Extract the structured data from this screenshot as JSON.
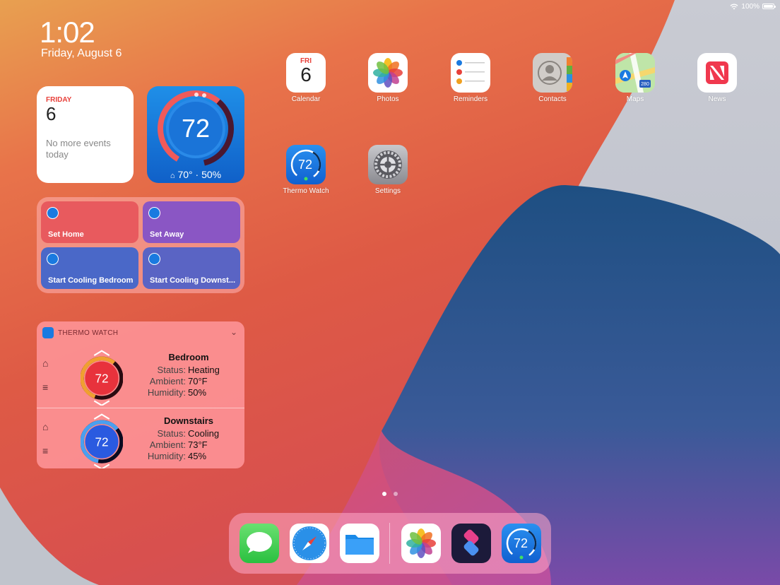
{
  "status": {
    "battery_text": "100%"
  },
  "lock": {
    "time": "1:02",
    "date": "Friday, August 6"
  },
  "calendar_widget": {
    "day": "FRIDAY",
    "num": "6",
    "note": "No more events today"
  },
  "thermo_widget": {
    "temp": "72",
    "ambient": "70°",
    "sep": "·",
    "humidity": "50%"
  },
  "shortcuts": [
    {
      "label": "Set Home"
    },
    {
      "label": "Set Away"
    },
    {
      "label": "Start Cooling Bedroom"
    },
    {
      "label": "Start Cooling Downst..."
    }
  ],
  "thermo_large": {
    "title": "THERMO WATCH",
    "rooms": [
      {
        "name": "Bedroom",
        "temp": "72",
        "status_k": "Status:",
        "status": "Heating",
        "ambient_k": "Ambient:",
        "ambient": "70°F",
        "humidity_k": "Humidity:",
        "humidity": "50%"
      },
      {
        "name": "Downstairs",
        "temp": "72",
        "status_k": "Status:",
        "status": "Cooling",
        "ambient_k": "Ambient:",
        "ambient": "73°F",
        "humidity_k": "Humidity:",
        "humidity": "45%"
      }
    ]
  },
  "apps": [
    {
      "label": "Calendar",
      "cal_day": "FRI",
      "cal_num": "6"
    },
    {
      "label": "Photos"
    },
    {
      "label": "Reminders"
    },
    {
      "label": "Contacts"
    },
    {
      "label": "Maps",
      "badge": "280"
    },
    {
      "label": "News"
    },
    {
      "label": "Thermo Watch",
      "temp": "72"
    },
    {
      "label": "Settings"
    }
  ],
  "dock": {
    "thermo_temp": "72"
  },
  "colors": {
    "heat": "#e8323c",
    "cool": "#2a5ae0",
    "thermo_blue": "#1a7ae0"
  }
}
